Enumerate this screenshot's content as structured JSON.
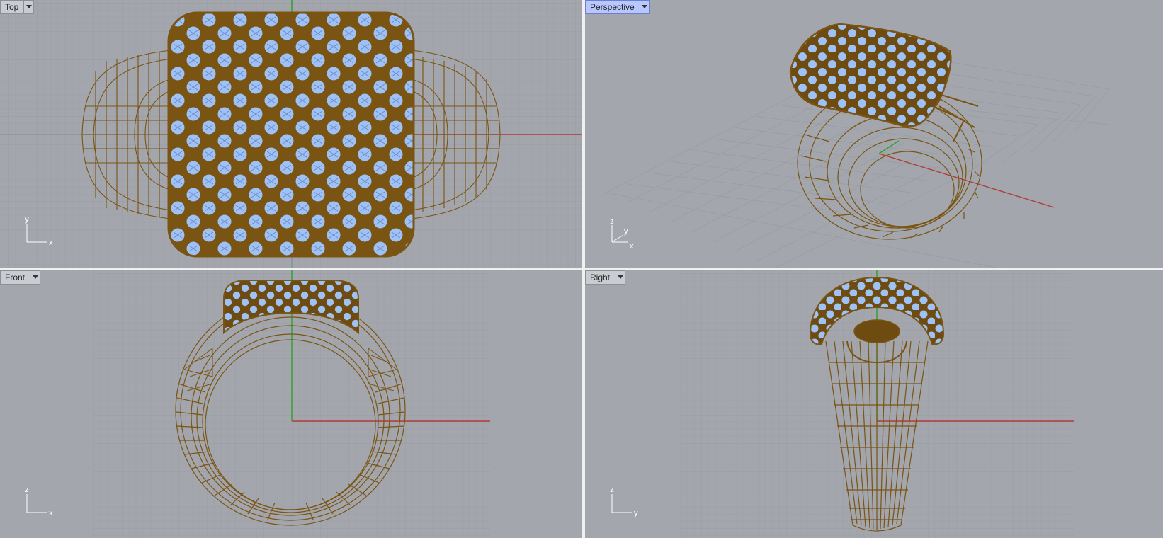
{
  "app": "Rhino 3D viewports",
  "viewports": [
    {
      "id": "top",
      "label": "Top",
      "active": false,
      "axis_h": "x",
      "axis_v": "y"
    },
    {
      "id": "perspective",
      "label": "Perspective",
      "active": true,
      "axis_x": "x",
      "axis_y": "y",
      "axis_z": "z"
    },
    {
      "id": "front",
      "label": "Front",
      "active": false,
      "axis_h": "x",
      "axis_v": "z"
    },
    {
      "id": "right",
      "label": "Right",
      "active": false,
      "axis_h": "y",
      "axis_v": "z"
    }
  ],
  "colors": {
    "viewport_bg": "#a3a6ac",
    "grid_minor": "#999ca2",
    "grid_major": "#8a8d93",
    "wire": "#7a5412",
    "gems": "#9ec2f5",
    "axis_x": "#b43a3a",
    "axis_y": "#2ea02e",
    "active_tab": "#b8c8ff"
  },
  "icons": {
    "viewport_menu": "chevron-down-icon"
  }
}
